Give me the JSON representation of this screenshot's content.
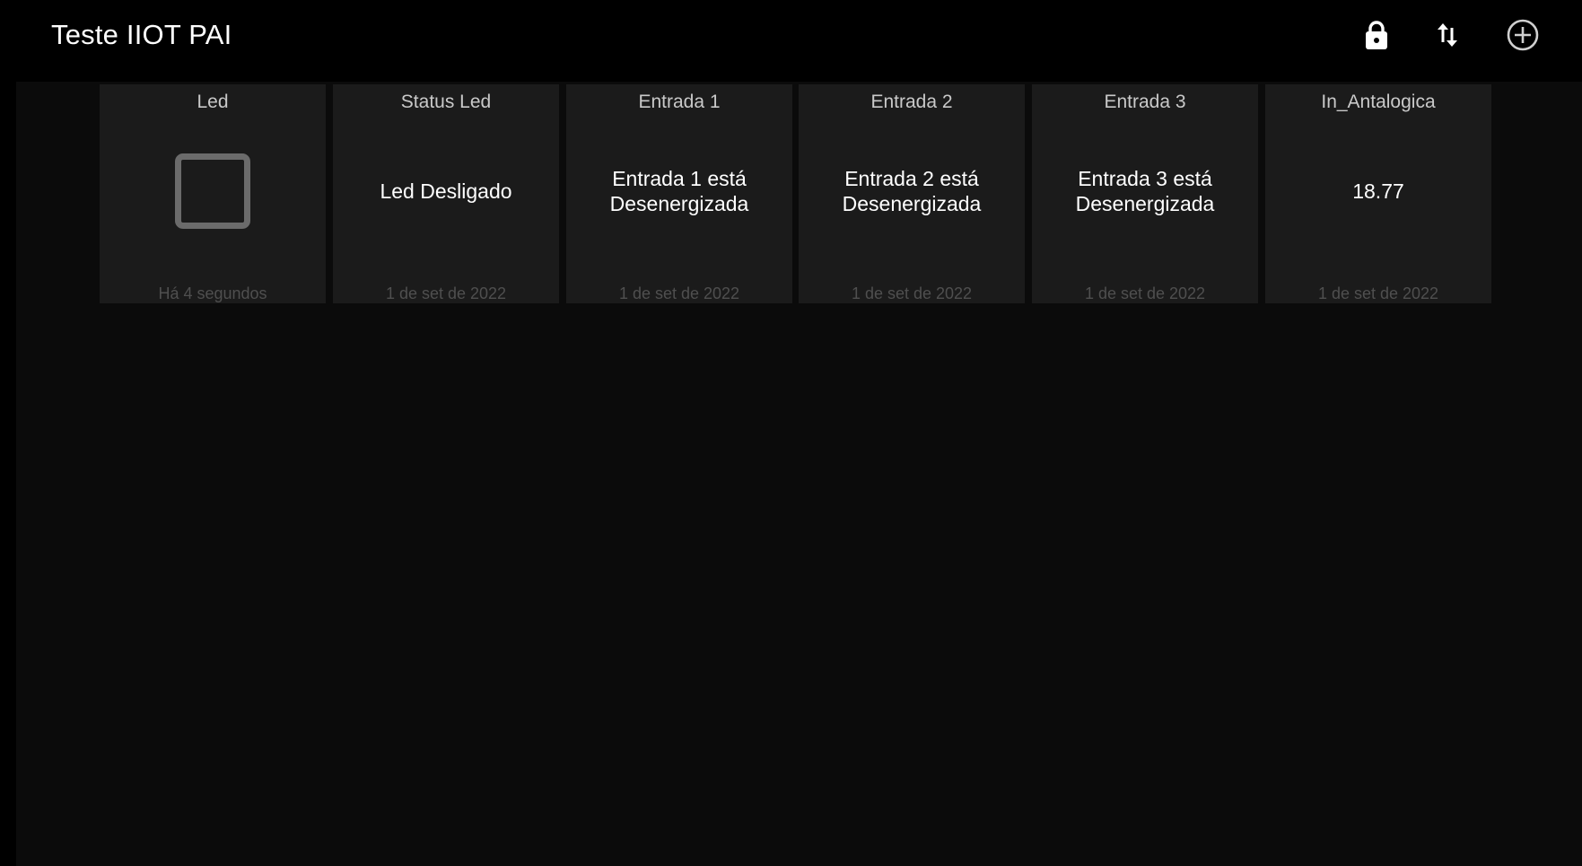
{
  "app": {
    "title": "Teste IIOT PAI"
  },
  "toolbar": {
    "lock_icon": "lock-icon",
    "sort_icon": "swap-vertical-icon",
    "add_icon": "add-circle-icon"
  },
  "tiles": [
    {
      "title": "Led",
      "widget": "checkbox",
      "checked": false,
      "footer": "Há 4 segundos"
    },
    {
      "title": "Status Led",
      "value": "Led Desligado",
      "footer": "1 de set de 2022"
    },
    {
      "title": "Entrada 1",
      "value": "Entrada 1 está Desenergizada",
      "footer": "1 de set de 2022"
    },
    {
      "title": "Entrada 2",
      "value": "Entrada 2 está Desenergizada",
      "footer": "1 de set de 2022"
    },
    {
      "title": "Entrada 3",
      "value": "Entrada 3 está Desenergizada",
      "footer": "1 de set de 2022"
    },
    {
      "title": "In_Antalogica",
      "value": "18.77",
      "footer": "1 de set de 2022"
    }
  ],
  "colors": {
    "background": "#000000",
    "dashboard": "#0b0b0b",
    "tile": "#1b1b1b",
    "checkbox_border": "#6b6b6b",
    "footer_text": "#4f4f4f"
  }
}
